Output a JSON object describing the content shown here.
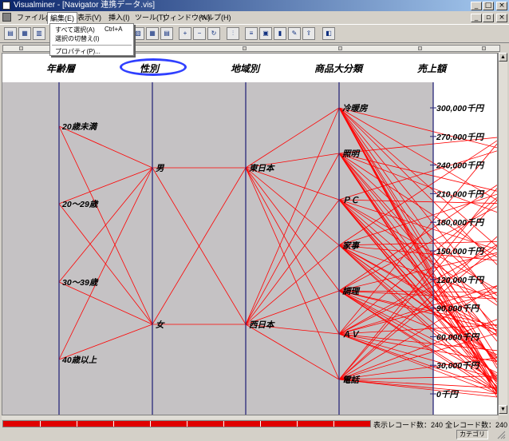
{
  "window": {
    "title": "Visualminer - [Navigator 連携データ.vis]",
    "controls": [
      "minimize",
      "maximize",
      "close"
    ],
    "mdi_controls": [
      "minimize",
      "restore",
      "close"
    ]
  },
  "menu": {
    "items": [
      "ファイル(F)",
      "編集(E)",
      "表示(V)",
      "挿入(I)",
      "ツール(T)",
      "ウィンドウ(W)",
      "ヘルプ(H)"
    ],
    "open_index": 1
  },
  "dropdown": {
    "items": [
      {
        "label": "すべて選択(A)",
        "shortcut": "Ctrl+A"
      },
      {
        "label": "選択の切替え(I)",
        "shortcut": ""
      },
      {
        "label": "プロパティ(P)...",
        "shortcut": ""
      }
    ],
    "highlighted_index": 2
  },
  "toolbar": {
    "icons": [
      "print-icon",
      "open-icon",
      "save-icon",
      "chart-icon",
      "grid-icon",
      "table-icon",
      "zoom-in-icon",
      "zoom-out-icon",
      "rotate-icon",
      "filter-icon",
      "sort-icon",
      "image-icon",
      "bar-icon",
      "pen-icon",
      "export-icon",
      "photo-icon",
      "stop-icon"
    ]
  },
  "axes": {
    "titles": [
      "年齢層",
      "性別",
      "地域別",
      "商品大分類",
      "売上額"
    ],
    "highlighted_title_index": 1,
    "age_labels": [
      "20歳未満",
      "20～29歳",
      "30～39歳",
      "40歳以上"
    ],
    "gender_labels": [
      "男",
      "女"
    ],
    "region_labels": [
      "東日本",
      "西日本"
    ],
    "category_labels": [
      "冷暖房",
      "照明",
      "ＰＣ",
      "家事",
      "調理",
      "ＡＶ",
      "電話"
    ],
    "sales_labels": [
      "300,000千円",
      "270,000千円",
      "240,000千円",
      "210,000千円",
      "180,000千円",
      "150,000千円",
      "120,000千円",
      "90,000千円",
      "60,000千円",
      "30,000千円",
      "0千円"
    ]
  },
  "colors": {
    "line": "#ff0000",
    "panel": "#c5c2c4",
    "axis": "#2a2a7a",
    "highlight": "#3040ff"
  },
  "status": {
    "displayed_records": "表示レコード数：240",
    "total_records": "全レコード数：240",
    "mode": "カテゴリ"
  }
}
